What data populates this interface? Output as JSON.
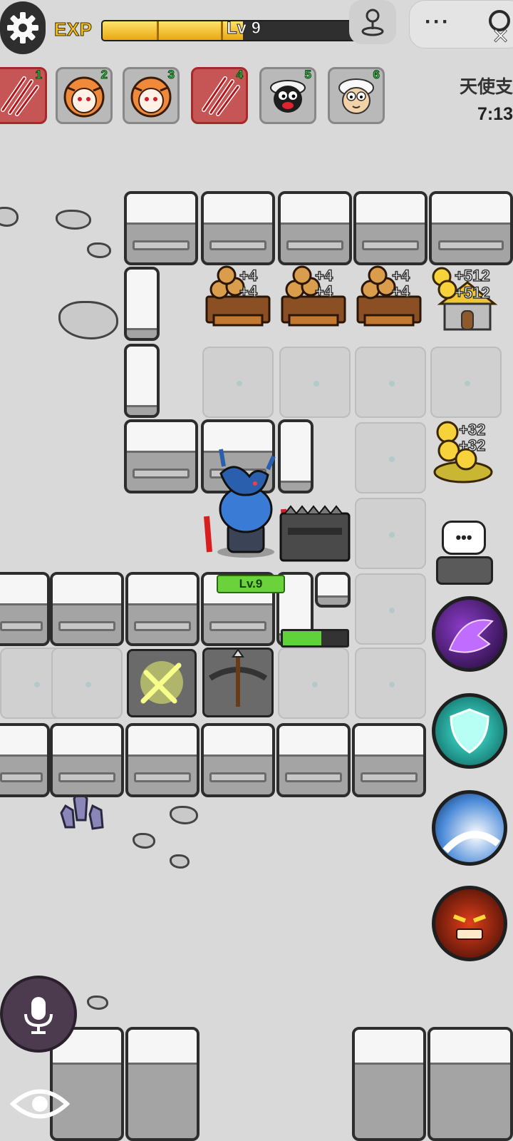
{
  "hud": {
    "exp_label": "EXP",
    "level_text": "Lv 9",
    "exp_progress": 0.55,
    "more_label": "···",
    "close_label": "✕"
  },
  "slots": [
    {
      "num": "1",
      "icon": "claw-scratch-icon",
      "state": "active"
    },
    {
      "num": "2",
      "icon": "tiger-sheep-icon",
      "state": "normal"
    },
    {
      "num": "3",
      "icon": "tiger-sheep-icon",
      "state": "normal"
    },
    {
      "num": "4",
      "icon": "claw-scratch-icon",
      "state": "active"
    },
    {
      "num": "5",
      "icon": "black-sheep-icon",
      "state": "normal"
    },
    {
      "num": "6",
      "icon": "sheep-icon",
      "state": "normal"
    }
  ],
  "top_right": {
    "title": "天使支",
    "time": "7:13"
  },
  "resources": {
    "wood_1": [
      "+4",
      "+4"
    ],
    "wood_2": [
      "+4",
      "+4"
    ],
    "wood_3": [
      "+4",
      "+4"
    ],
    "gold_house": [
      "+512",
      "+512"
    ],
    "gold_pile": [
      "+32",
      "+32"
    ]
  },
  "player": {
    "level_badge": "Lv.9",
    "hp_progress": 0.6
  },
  "chat_icon": "speech-bubble-icon",
  "skills": [
    "purple-beast-skill-icon",
    "cyan-shield-skill-icon",
    "ice-slash-skill-icon",
    "rage-face-skill-icon"
  ],
  "colors": {
    "exp_fill": "#f2b91a",
    "level_badge": "#6ad23b",
    "active_slot": "#c65555"
  }
}
